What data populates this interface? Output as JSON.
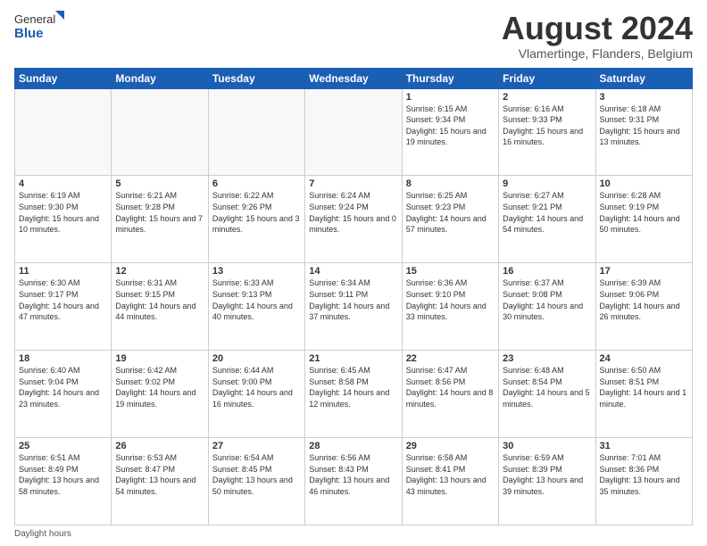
{
  "header": {
    "logo_line1": "General",
    "logo_line2": "Blue",
    "title": "August 2024",
    "location": "Vlamertinge, Flanders, Belgium"
  },
  "days_of_week": [
    "Sunday",
    "Monday",
    "Tuesday",
    "Wednesday",
    "Thursday",
    "Friday",
    "Saturday"
  ],
  "weeks": [
    [
      {
        "day": "",
        "info": ""
      },
      {
        "day": "",
        "info": ""
      },
      {
        "day": "",
        "info": ""
      },
      {
        "day": "",
        "info": ""
      },
      {
        "day": "1",
        "info": "Sunrise: 6:15 AM\nSunset: 9:34 PM\nDaylight: 15 hours and 19 minutes."
      },
      {
        "day": "2",
        "info": "Sunrise: 6:16 AM\nSunset: 9:33 PM\nDaylight: 15 hours and 16 minutes."
      },
      {
        "day": "3",
        "info": "Sunrise: 6:18 AM\nSunset: 9:31 PM\nDaylight: 15 hours and 13 minutes."
      }
    ],
    [
      {
        "day": "4",
        "info": "Sunrise: 6:19 AM\nSunset: 9:30 PM\nDaylight: 15 hours and 10 minutes."
      },
      {
        "day": "5",
        "info": "Sunrise: 6:21 AM\nSunset: 9:28 PM\nDaylight: 15 hours and 7 minutes."
      },
      {
        "day": "6",
        "info": "Sunrise: 6:22 AM\nSunset: 9:26 PM\nDaylight: 15 hours and 3 minutes."
      },
      {
        "day": "7",
        "info": "Sunrise: 6:24 AM\nSunset: 9:24 PM\nDaylight: 15 hours and 0 minutes."
      },
      {
        "day": "8",
        "info": "Sunrise: 6:25 AM\nSunset: 9:23 PM\nDaylight: 14 hours and 57 minutes."
      },
      {
        "day": "9",
        "info": "Sunrise: 6:27 AM\nSunset: 9:21 PM\nDaylight: 14 hours and 54 minutes."
      },
      {
        "day": "10",
        "info": "Sunrise: 6:28 AM\nSunset: 9:19 PM\nDaylight: 14 hours and 50 minutes."
      }
    ],
    [
      {
        "day": "11",
        "info": "Sunrise: 6:30 AM\nSunset: 9:17 PM\nDaylight: 14 hours and 47 minutes."
      },
      {
        "day": "12",
        "info": "Sunrise: 6:31 AM\nSunset: 9:15 PM\nDaylight: 14 hours and 44 minutes."
      },
      {
        "day": "13",
        "info": "Sunrise: 6:33 AM\nSunset: 9:13 PM\nDaylight: 14 hours and 40 minutes."
      },
      {
        "day": "14",
        "info": "Sunrise: 6:34 AM\nSunset: 9:11 PM\nDaylight: 14 hours and 37 minutes."
      },
      {
        "day": "15",
        "info": "Sunrise: 6:36 AM\nSunset: 9:10 PM\nDaylight: 14 hours and 33 minutes."
      },
      {
        "day": "16",
        "info": "Sunrise: 6:37 AM\nSunset: 9:08 PM\nDaylight: 14 hours and 30 minutes."
      },
      {
        "day": "17",
        "info": "Sunrise: 6:39 AM\nSunset: 9:06 PM\nDaylight: 14 hours and 26 minutes."
      }
    ],
    [
      {
        "day": "18",
        "info": "Sunrise: 6:40 AM\nSunset: 9:04 PM\nDaylight: 14 hours and 23 minutes."
      },
      {
        "day": "19",
        "info": "Sunrise: 6:42 AM\nSunset: 9:02 PM\nDaylight: 14 hours and 19 minutes."
      },
      {
        "day": "20",
        "info": "Sunrise: 6:44 AM\nSunset: 9:00 PM\nDaylight: 14 hours and 16 minutes."
      },
      {
        "day": "21",
        "info": "Sunrise: 6:45 AM\nSunset: 8:58 PM\nDaylight: 14 hours and 12 minutes."
      },
      {
        "day": "22",
        "info": "Sunrise: 6:47 AM\nSunset: 8:56 PM\nDaylight: 14 hours and 8 minutes."
      },
      {
        "day": "23",
        "info": "Sunrise: 6:48 AM\nSunset: 8:54 PM\nDaylight: 14 hours and 5 minutes."
      },
      {
        "day": "24",
        "info": "Sunrise: 6:50 AM\nSunset: 8:51 PM\nDaylight: 14 hours and 1 minute."
      }
    ],
    [
      {
        "day": "25",
        "info": "Sunrise: 6:51 AM\nSunset: 8:49 PM\nDaylight: 13 hours and 58 minutes."
      },
      {
        "day": "26",
        "info": "Sunrise: 6:53 AM\nSunset: 8:47 PM\nDaylight: 13 hours and 54 minutes."
      },
      {
        "day": "27",
        "info": "Sunrise: 6:54 AM\nSunset: 8:45 PM\nDaylight: 13 hours and 50 minutes."
      },
      {
        "day": "28",
        "info": "Sunrise: 6:56 AM\nSunset: 8:43 PM\nDaylight: 13 hours and 46 minutes."
      },
      {
        "day": "29",
        "info": "Sunrise: 6:58 AM\nSunset: 8:41 PM\nDaylight: 13 hours and 43 minutes."
      },
      {
        "day": "30",
        "info": "Sunrise: 6:59 AM\nSunset: 8:39 PM\nDaylight: 13 hours and 39 minutes."
      },
      {
        "day": "31",
        "info": "Sunrise: 7:01 AM\nSunset: 8:36 PM\nDaylight: 13 hours and 35 minutes."
      }
    ]
  ],
  "footer": {
    "note": "Daylight hours"
  }
}
